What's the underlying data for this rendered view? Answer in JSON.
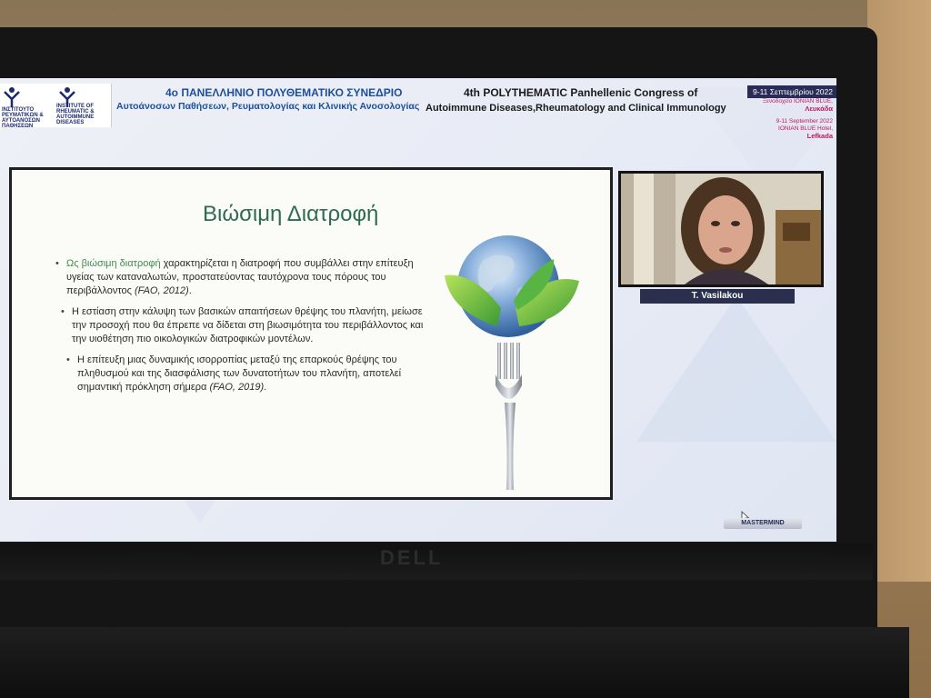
{
  "header": {
    "logo1_text": "ΙΝΣΤΙΤΟΥΤΟ ΡΕΥΜΑΤΙΚΩΝ & ΑΥΤΟΑΝΟΣΩΝ ΠΑΘΗΣΕΩΝ",
    "logo2_text": "INSTITUTE OF RHEUMATIC & AUTOIMMUNE DISEASES",
    "greek_title": "4ο ΠΑΝΕΛΛΗΝΙΟ ΠΟΛΥΘΕΜΑΤΙΚΟ ΣΥΝΕΔΡΙΟ",
    "greek_subtitle": "Αυτοάνοσων Παθήσεων, Ρευματολογίας και Κλινικής Ανοσολογίας",
    "english_title": "4th POLYTHEMATIC Panhellenic Congress of",
    "english_subtitle": "Autoimmune Diseases,Rheumatology and Clinical Immunology",
    "date_greek": "9-11 Σεπτεμβρίου 2022",
    "venue_greek": "Ξενοδοχείο IONIAN BLUE,",
    "city_greek": "Λευκάδα",
    "date_english": "9-11 September 2022",
    "venue_english": "IONIAN BLUE Hotel,",
    "city_english": "Lefkada"
  },
  "slide": {
    "title": "Βιώσιμη Διατροφή",
    "bullet1_highlight": "Ως βιώσιμη διατροφή",
    "bullet1_text": " χαρακτηρίζεται η διατροφή που συμβάλλει στην επίτευξη υγείας των καταναλωτών, προστατεύοντας ταυτόχρονα τους πόρους του περιβάλλοντος ",
    "bullet1_cite": "(FAO, 2012)",
    "bullet1_end": ".",
    "bullet2_text": "Η εστίαση στην κάλυψη των βασικών απαιτήσεων θρέψης του πλανήτη, μείωσε την προσοχή που θα έπρεπε να δίδεται στη βιωσιμότητα του περιβάλλοντος και την υιοθέτηση πιο οικολογικών διατροφικών μοντέλων.",
    "bullet3_text": "Η επίτευξη μιας δυναμικής ισορροπίας μεταξύ της επαρκούς θρέψης του πληθυσμού και της διασφάλισης των δυνατοτήτων του πλανήτη, αποτελεί σημαντική πρόκληση σήμερα ",
    "bullet3_cite": "(FAO, 2019)",
    "bullet3_end": ".",
    "image_icon": "globe-on-fork-with-leaves"
  },
  "webcam": {
    "participant_name": "T. Vasilakou"
  },
  "footer": {
    "sponsor_label": "MASTERMIND"
  },
  "device": {
    "brand": "DELL"
  },
  "colors": {
    "slide_title": "#2e6b52",
    "highlight": "#3f8b4e",
    "header_blue": "#1d4f9c",
    "name_tag_bg": "#2a2f4d",
    "date_accent": "#c2185b"
  }
}
